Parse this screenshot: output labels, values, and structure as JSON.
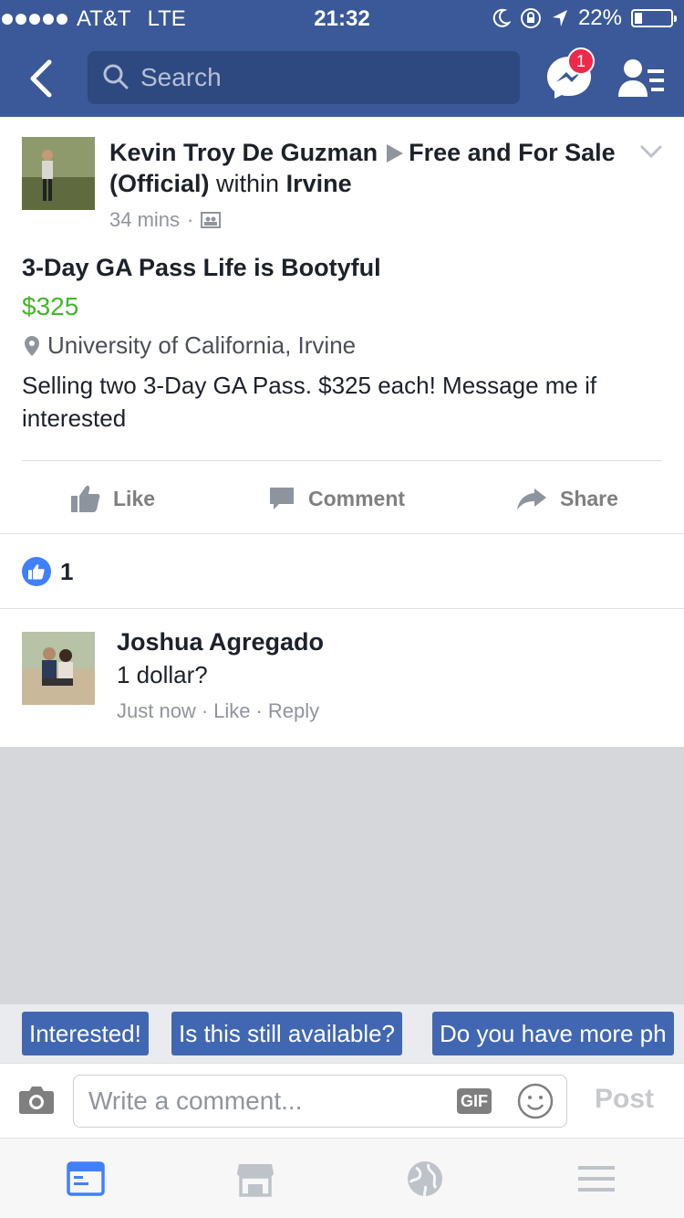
{
  "status_bar": {
    "carrier": "AT&T",
    "network": "LTE",
    "time": "21:32",
    "battery": "22%",
    "battery_level": 0.22
  },
  "nav": {
    "search_placeholder": "Search",
    "messenger_badge": "1"
  },
  "post": {
    "author": "Kevin Troy De Guzman",
    "group": "Free and For Sale (Official)",
    "within_text": "within",
    "location_tag": "Irvine",
    "time": "34 mins",
    "title": "3-Day GA Pass Life is Bootyful",
    "price": "$325",
    "location": "University of California, Irvine",
    "description": "Selling two 3-Day GA Pass. $325 each! Message me if interested"
  },
  "actions": {
    "like": "Like",
    "comment": "Comment",
    "share": "Share"
  },
  "reactions": {
    "count": "1"
  },
  "comment": {
    "author": "Joshua Agregado",
    "text": "1 dollar?",
    "time": "Just now",
    "like": "Like",
    "reply": "Reply"
  },
  "quick_replies": [
    "Interested!",
    "Is this still available?",
    "Do you have more ph"
  ],
  "composer": {
    "placeholder": "Write a comment...",
    "gif": "GIF",
    "post": "Post"
  },
  "colors": {
    "brand": "#3b5998",
    "price": "#42b72a",
    "chip": "#4267b2",
    "active_tab": "#4080ff"
  }
}
